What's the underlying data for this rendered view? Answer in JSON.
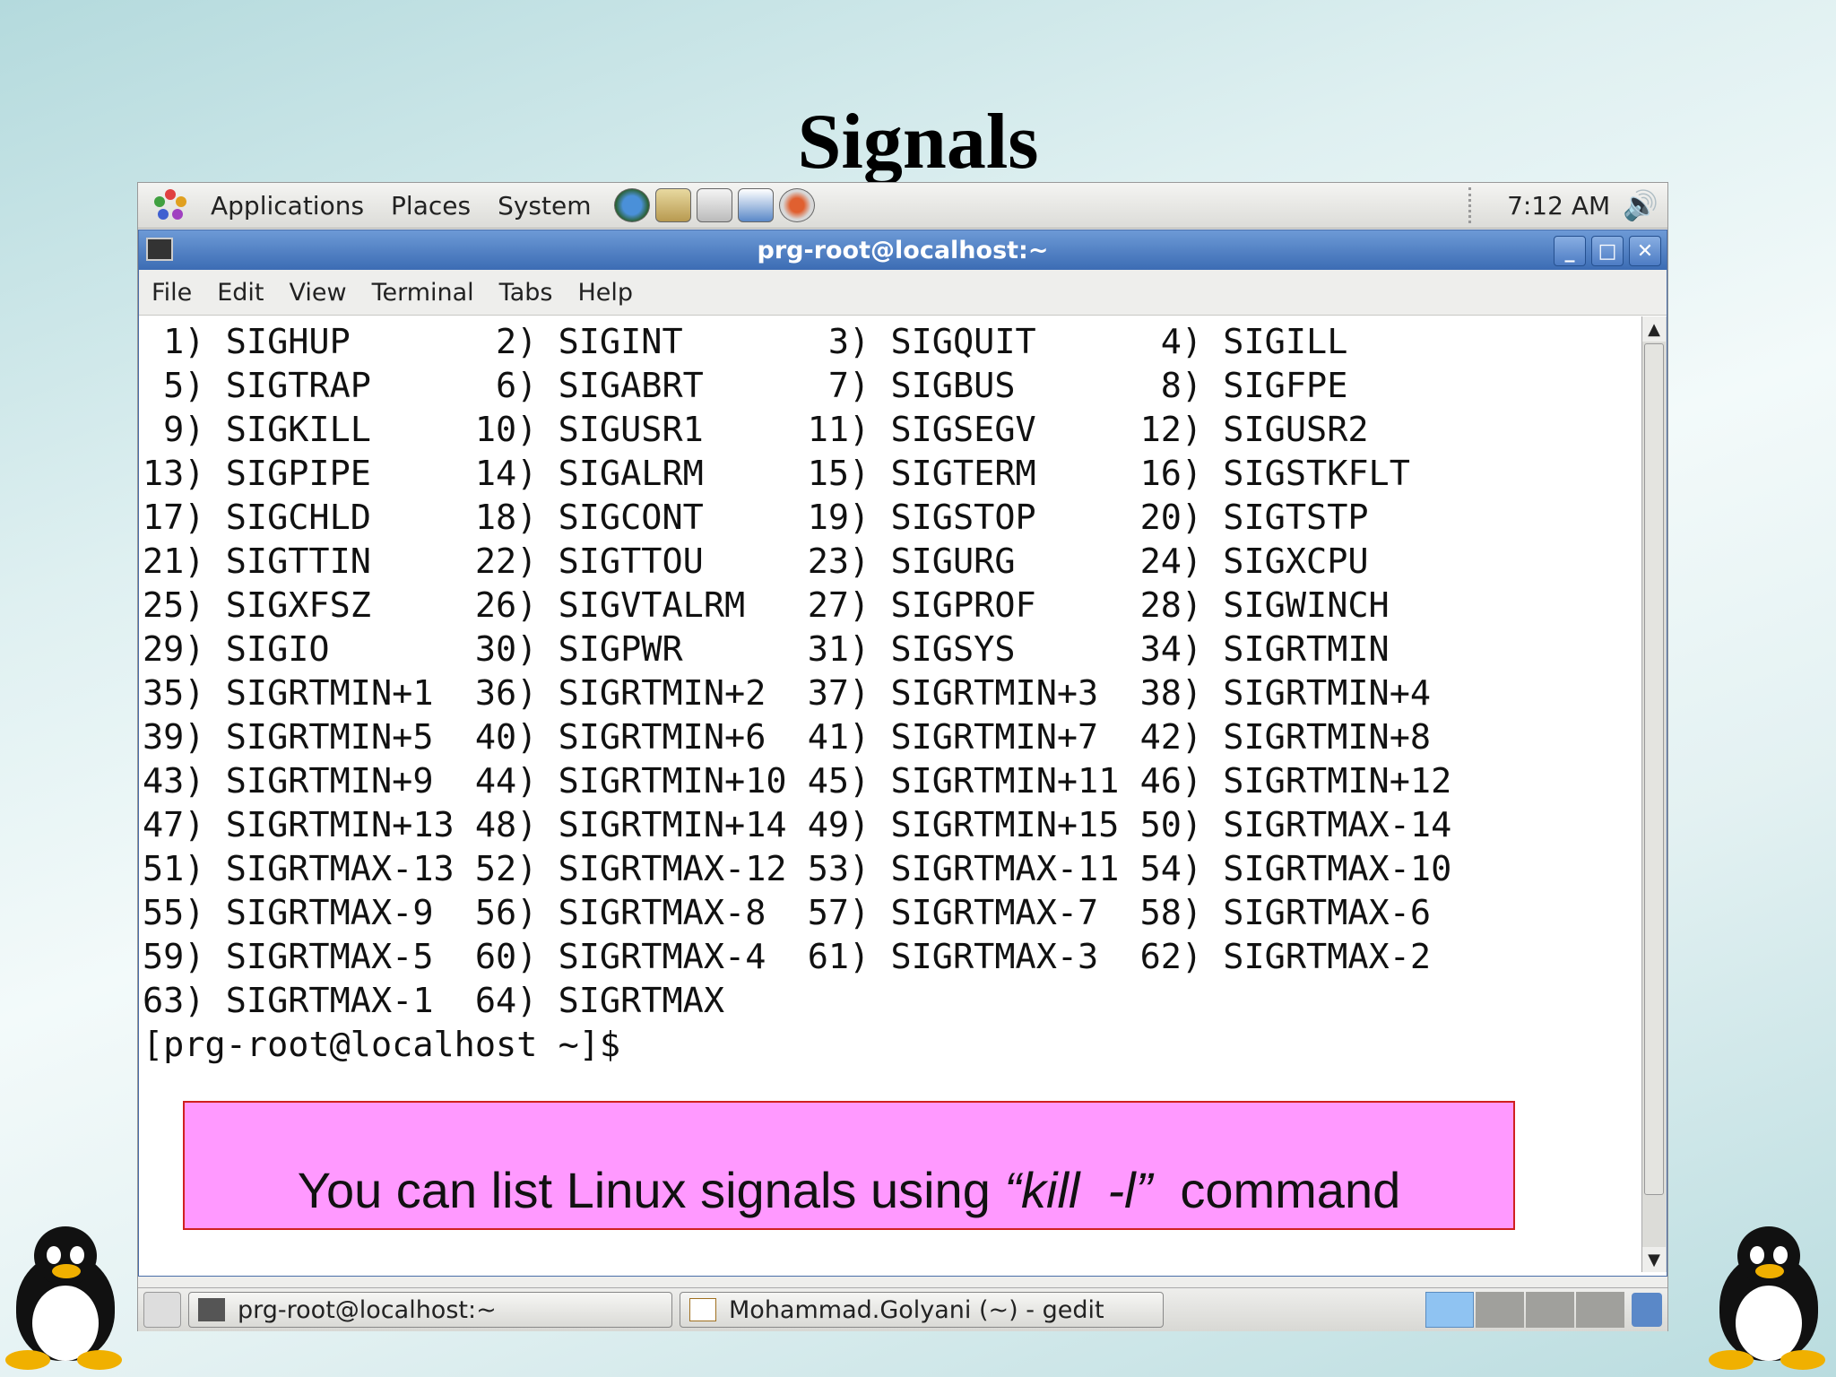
{
  "slide": {
    "title": "Signals"
  },
  "top_panel": {
    "menus": [
      "Applications",
      "Places",
      "System"
    ],
    "launchers": [
      "web-browser-icon",
      "email-icon",
      "notes-icon",
      "presentation-icon",
      "update-icon"
    ],
    "clock": "7:12 AM",
    "volume_icon": "volume-icon"
  },
  "window": {
    "title": "prg-root@localhost:~",
    "menu": [
      "File",
      "Edit",
      "View",
      "Terminal",
      "Tabs",
      "Help"
    ],
    "buttons": {
      "minimize": "_",
      "maximize": "□",
      "close": "✕"
    }
  },
  "terminal": {
    "lines": [
      " 1) SIGHUP       2) SIGINT       3) SIGQUIT      4) SIGILL",
      " 5) SIGTRAP      6) SIGABRT      7) SIGBUS       8) SIGFPE",
      " 9) SIGKILL     10) SIGUSR1     11) SIGSEGV     12) SIGUSR2",
      "13) SIGPIPE     14) SIGALRM     15) SIGTERM     16) SIGSTKFLT",
      "17) SIGCHLD     18) SIGCONT     19) SIGSTOP     20) SIGTSTP",
      "21) SIGTTIN     22) SIGTTOU     23) SIGURG      24) SIGXCPU",
      "25) SIGXFSZ     26) SIGVTALRM   27) SIGPROF     28) SIGWINCH",
      "29) SIGIO       30) SIGPWR      31) SIGSYS      34) SIGRTMIN",
      "35) SIGRTMIN+1  36) SIGRTMIN+2  37) SIGRTMIN+3  38) SIGRTMIN+4",
      "39) SIGRTMIN+5  40) SIGRTMIN+6  41) SIGRTMIN+7  42) SIGRTMIN+8",
      "43) SIGRTMIN+9  44) SIGRTMIN+10 45) SIGRTMIN+11 46) SIGRTMIN+12",
      "47) SIGRTMIN+13 48) SIGRTMIN+14 49) SIGRTMIN+15 50) SIGRTMAX-14",
      "51) SIGRTMAX-13 52) SIGRTMAX-12 53) SIGRTMAX-11 54) SIGRTMAX-10",
      "55) SIGRTMAX-9  56) SIGRTMAX-8  57) SIGRTMAX-7  58) SIGRTMAX-6",
      "59) SIGRTMAX-5  60) SIGRTMAX-4  61) SIGRTMAX-3  62) SIGRTMAX-2",
      "63) SIGRTMAX-1  64) SIGRTMAX",
      "[prg-root@localhost ~]$"
    ]
  },
  "callout": {
    "prefix": "You can list Linux signals using ",
    "command": "“kill  -l”",
    "suffix": "  command"
  },
  "bottom_panel": {
    "tasks": [
      "prg-root@localhost:~",
      "Mohammad.Golyani (~) - gedit"
    ],
    "workspace_count": 4
  }
}
